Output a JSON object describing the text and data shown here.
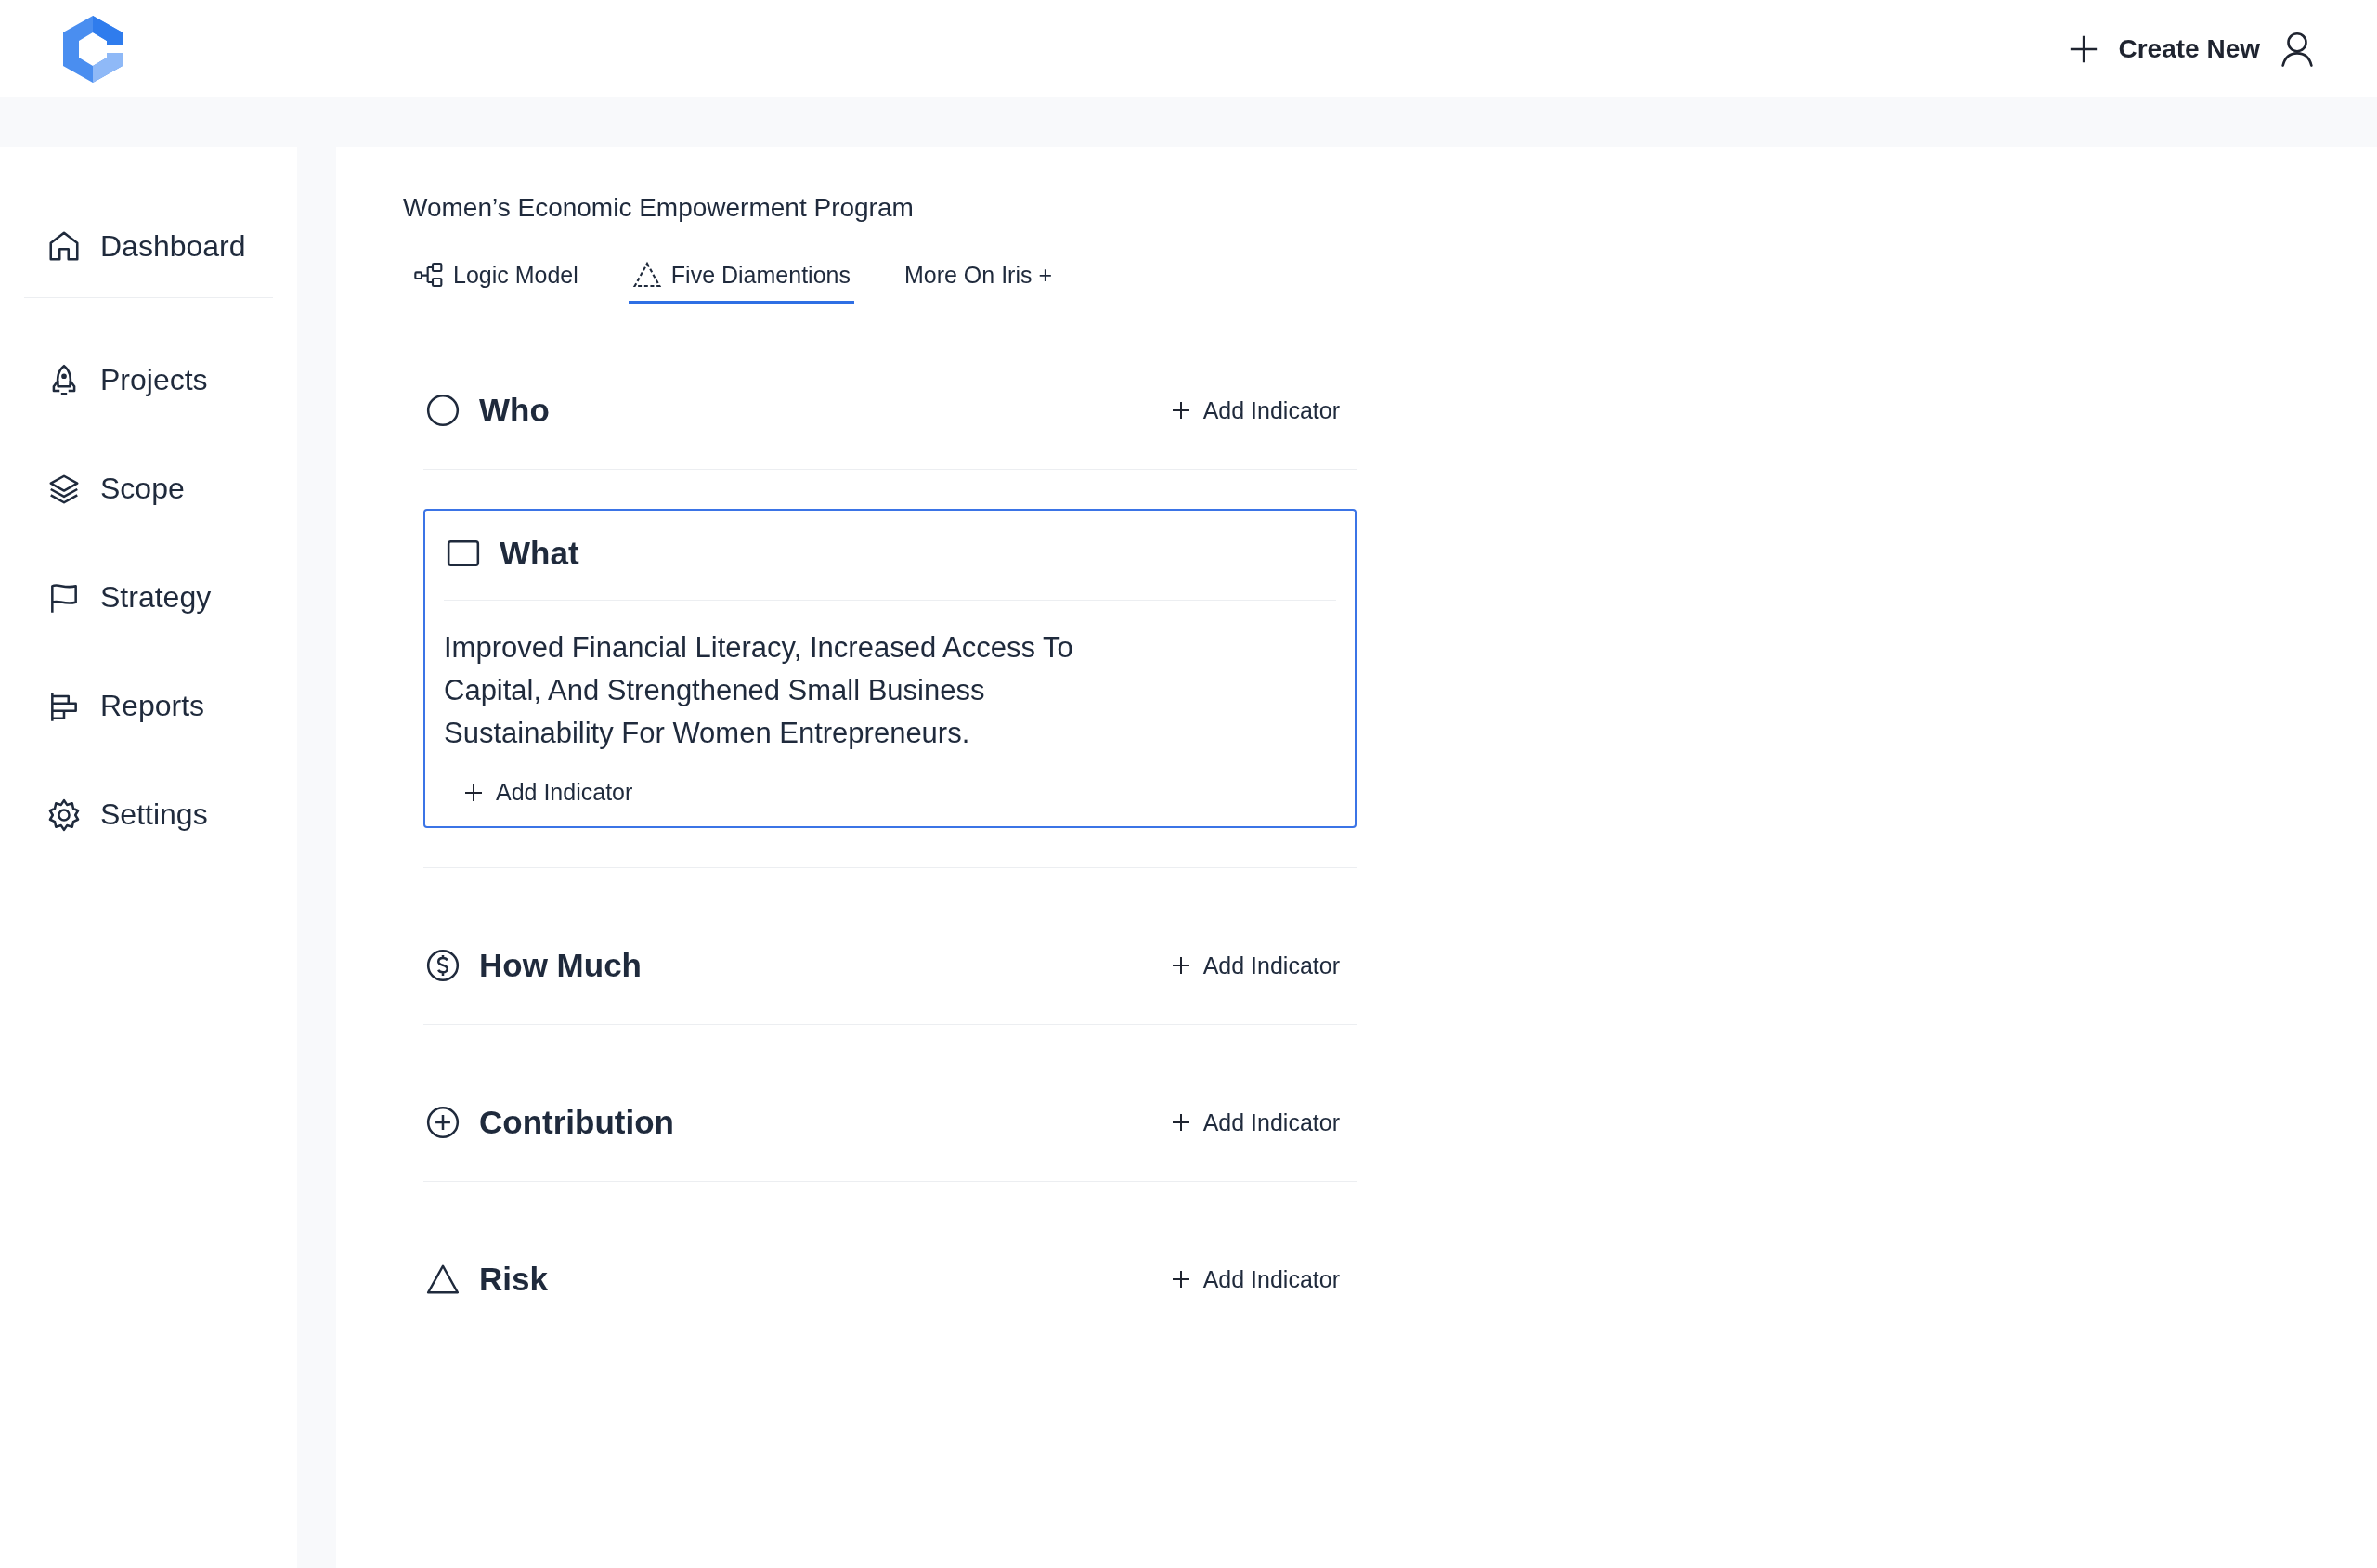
{
  "header": {
    "create_button": "Create New"
  },
  "sidebar": {
    "items": [
      {
        "label": "Dashboard",
        "selected": false
      },
      {
        "label": "Projects",
        "selected": false
      },
      {
        "label": "Scope",
        "selected": false
      },
      {
        "label": "Strategy",
        "selected": false
      },
      {
        "label": "Reports",
        "selected": false
      },
      {
        "label": "Settings",
        "selected": false
      }
    ]
  },
  "page": {
    "title": "Women’s Economic Empowerment Program",
    "tabs": [
      {
        "label": "Logic Model",
        "selected": false
      },
      {
        "label": "Five Diamentions",
        "selected": true
      },
      {
        "label": "More On Iris +",
        "selected": false
      }
    ],
    "sections": [
      {
        "title": "Who",
        "expanded": false,
        "action": "Add Indicator"
      },
      {
        "title": "What",
        "expanded": true,
        "description": "Improved Financial Literacy, Increased Access To Capital, And Strengthened Small Business Sustainability For Women Entrepreneurs.",
        "action": "Add Indicator"
      },
      {
        "title": "How Much",
        "expanded": false,
        "action": "Add Indicator"
      },
      {
        "title": "Contribution",
        "expanded": false,
        "action": "Add Indicator"
      },
      {
        "title": "Risk",
        "expanded": false,
        "action": "Add Indicator"
      }
    ]
  }
}
